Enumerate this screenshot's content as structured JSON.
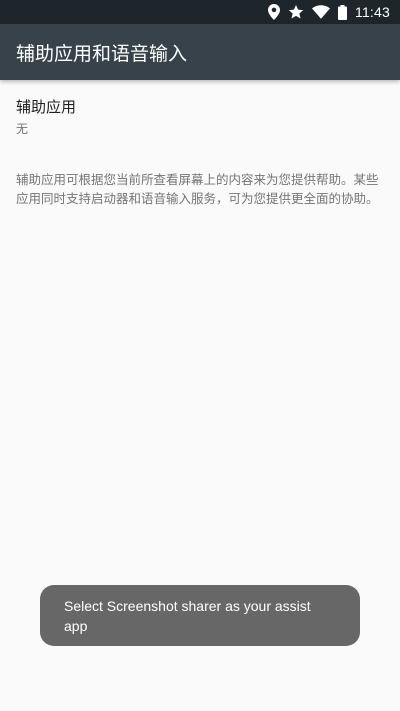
{
  "status_bar": {
    "icons": [
      "location-icon",
      "star-icon",
      "wifi-icon",
      "battery-icon"
    ],
    "time": "11:43"
  },
  "app_bar": {
    "title": "辅助应用和语音输入"
  },
  "preference": {
    "title": "辅助应用",
    "summary": "无"
  },
  "description": "辅助应用可根据您当前所查看屏幕上的内容来为您提供帮助。某些应用同时支持启动器和语音输入服务，可为您提供更全面的协助。",
  "toast": {
    "message": "Select Screenshot sharer as your assist app"
  },
  "colors": {
    "status_bar": "#1f262b",
    "app_bar": "#37424a",
    "background": "#fafafa",
    "toast": "#676767"
  }
}
